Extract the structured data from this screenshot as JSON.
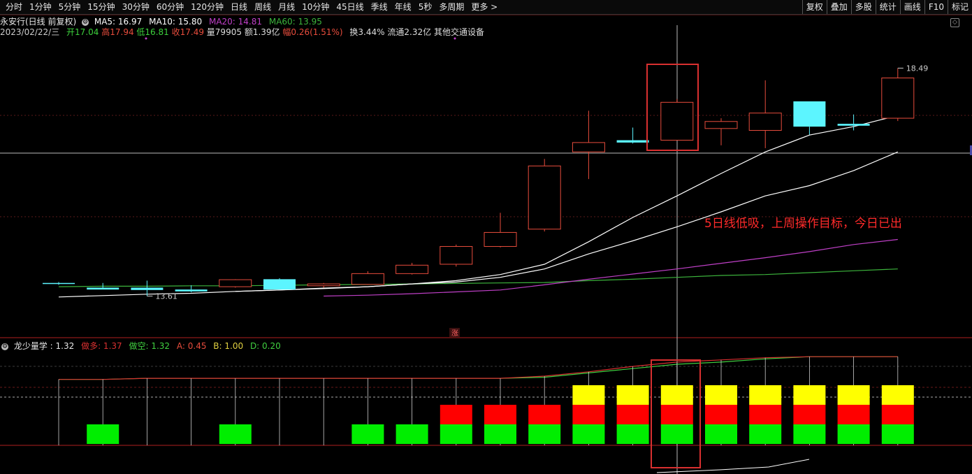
{
  "toolbar": {
    "tabs": [
      "分时",
      "1分钟",
      "5分钟",
      "15分钟",
      "30分钟",
      "60分钟",
      "120分钟",
      "日线",
      "周线",
      "月线",
      "10分钟",
      "45日线",
      "季线",
      "年线",
      "5秒",
      "多周期",
      "更多 >"
    ],
    "right": [
      "复权",
      "叠加",
      "多股",
      "统计",
      "画线",
      "F10",
      "标记"
    ]
  },
  "info": {
    "stock": "永安行(日线 前复权)",
    "ma5": "MA5: 16.97",
    "ma10": "MA10: 15.80",
    "ma20": "MA20: 14.81",
    "ma60": "MA60: 13.95",
    "date": "2023/02/22/三",
    "open": "开17.04",
    "high": "高17.94",
    "low": "低16.81",
    "close": "收17.49",
    "vol": "量79905",
    "amt": "额1.39亿",
    "chg": "幅0.26(1.51%)",
    "turnover": "换3.44%",
    "float": "流通2.32亿",
    "sector": "其他交通设备"
  },
  "indicator": {
    "name": "龙少量学",
    "value": ": 1.32",
    "duo": "做多: 1.37",
    "kong": "做空: 1.32",
    "a": "A: 0.45",
    "b": "B: 1.00",
    "d": "D: 0.20"
  },
  "annotation": "5日线低吸，上周操作目标，今日已出",
  "labels": {
    "high_label": "18.49",
    "low_label": "13.61",
    "zhang": "涨"
  },
  "colors": {
    "up": "#e74c3c",
    "down": "#5cf5ff",
    "ma5": "#ffffff",
    "ma10": "#ffffff",
    "ma20": "#c040c8",
    "ma60": "#3cb43c",
    "annotation": "#ff2a2a",
    "highlight": "#d93030",
    "yellow": "#ffff00",
    "red": "#ff0000",
    "green": "#00ee00",
    "duo": "#d83030",
    "kong": "#40d040"
  },
  "chart_data": {
    "type": "candlestick",
    "price_ylim": [
      13.0,
      18.9
    ],
    "candles": [
      {
        "o": 13.9,
        "h": 13.92,
        "l": 13.86,
        "c": 13.88
      },
      {
        "o": 13.8,
        "h": 13.9,
        "l": 13.76,
        "c": 13.76
      },
      {
        "o": 13.8,
        "h": 13.95,
        "l": 13.62,
        "c": 13.75
      },
      {
        "o": 13.76,
        "h": 13.85,
        "l": 13.7,
        "c": 13.72
      },
      {
        "o": 13.82,
        "h": 13.98,
        "l": 13.8,
        "c": 13.97
      },
      {
        "o": 13.98,
        "h": 14.0,
        "l": 13.76,
        "c": 13.76
      },
      {
        "o": 13.84,
        "h": 13.9,
        "l": 13.8,
        "c": 13.88
      },
      {
        "o": 13.87,
        "h": 14.15,
        "l": 13.86,
        "c": 14.1
      },
      {
        "o": 14.1,
        "h": 14.33,
        "l": 14.08,
        "c": 14.28
      },
      {
        "o": 14.3,
        "h": 14.72,
        "l": 14.25,
        "c": 14.68
      },
      {
        "o": 14.68,
        "h": 15.4,
        "l": 14.66,
        "c": 14.98
      },
      {
        "o": 15.05,
        "h": 16.55,
        "l": 15.0,
        "c": 16.4
      },
      {
        "o": 16.7,
        "h": 17.58,
        "l": 16.12,
        "c": 16.9
      },
      {
        "o": 16.95,
        "h": 17.22,
        "l": 16.88,
        "c": 16.9
      },
      {
        "o": 16.95,
        "h": 17.83,
        "l": 16.98,
        "c": 17.76
      },
      {
        "o": 17.2,
        "h": 17.42,
        "l": 16.84,
        "c": 17.35
      },
      {
        "o": 17.16,
        "h": 18.23,
        "l": 16.78,
        "c": 17.53
      },
      {
        "o": 17.78,
        "h": 17.76,
        "l": 17.07,
        "c": 17.24
      },
      {
        "o": 17.3,
        "h": 17.5,
        "l": 17.16,
        "c": 17.26
      },
      {
        "o": 17.42,
        "h": 18.49,
        "l": 17.36,
        "c": 18.28
      }
    ],
    "ma5": [
      13.6,
      13.63,
      13.66,
      13.68,
      13.72,
      13.75,
      13.78,
      13.82,
      13.88,
      13.95,
      14.08,
      14.3,
      14.78,
      15.3,
      15.76,
      16.24,
      16.7,
      17.06,
      17.24,
      17.48
    ],
    "ma10": [
      null,
      null,
      null,
      null,
      13.72,
      13.75,
      13.79,
      13.82,
      13.88,
      13.92,
      14.02,
      14.2,
      14.52,
      14.8,
      15.1,
      15.42,
      15.76,
      15.98,
      16.3,
      16.7
    ],
    "ma20": [
      null,
      null,
      null,
      null,
      null,
      null,
      13.62,
      13.64,
      13.67,
      13.71,
      13.75,
      13.86,
      13.98,
      14.09,
      14.2,
      14.32,
      14.44,
      14.57,
      14.72,
      14.83
    ],
    "ma60": [
      13.82,
      13.83,
      13.83,
      13.84,
      13.84,
      13.85,
      13.86,
      13.87,
      13.88,
      13.89,
      13.9,
      13.91,
      13.95,
      13.98,
      14.02,
      14.06,
      14.08,
      14.12,
      14.16,
      14.2
    ],
    "indicator_ylim": [
      0.55,
      1.41
    ],
    "duo": [
      1.16,
      1.16,
      1.17,
      1.17,
      1.17,
      1.17,
      1.17,
      1.17,
      1.17,
      1.17,
      1.17,
      1.19,
      1.23,
      1.28,
      1.32,
      1.34,
      1.36,
      1.37,
      1.37,
      1.37
    ],
    "kong": [
      1.16,
      1.16,
      1.17,
      1.17,
      1.17,
      1.17,
      1.17,
      1.17,
      1.17,
      1.17,
      1.17,
      1.18,
      1.22,
      1.26,
      1.3,
      1.32,
      1.35,
      1.37,
      1.37,
      1.37
    ],
    "stack": [
      0,
      1,
      0,
      0,
      1,
      0,
      0,
      1,
      1,
      2,
      2,
      2,
      3,
      3,
      3,
      3,
      3,
      3,
      3,
      3
    ]
  }
}
